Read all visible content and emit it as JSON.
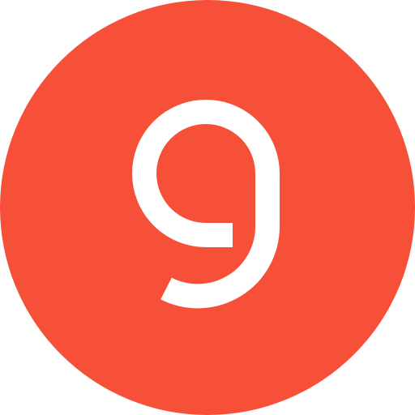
{
  "badge": {
    "numeral": "9",
    "icon": "number-nine-circle-icon",
    "colors": {
      "background": "#F65138",
      "numeral": "#FFFFFF"
    }
  }
}
